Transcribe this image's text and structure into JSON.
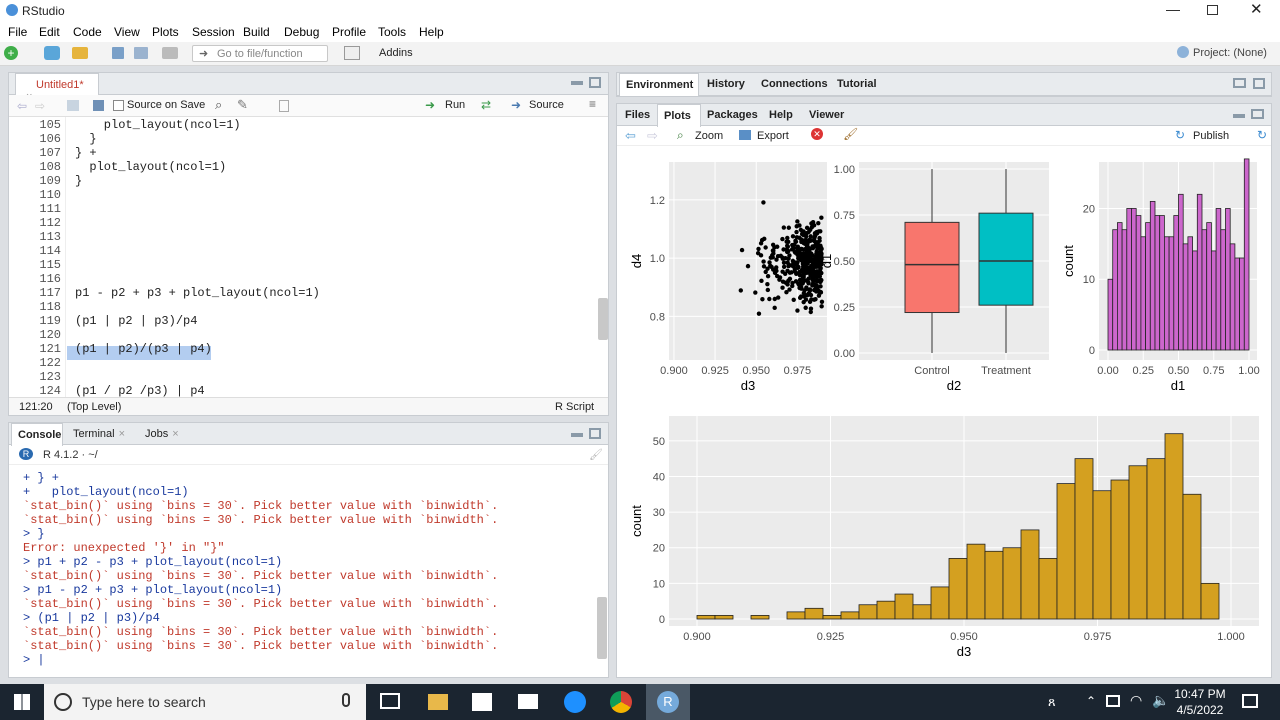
{
  "window": {
    "title": "RStudio"
  },
  "menu": [
    "File",
    "Edit",
    "Code",
    "View",
    "Plots",
    "Session",
    "Build",
    "Debug",
    "Profile",
    "Tools",
    "Help"
  ],
  "toolbar": {
    "goto_placeholder": "Go to file/function",
    "addins": "Addins",
    "project": "Project: (None)"
  },
  "editor": {
    "tab": "Untitled1*",
    "source_on_save": "Source on Save",
    "run": "Run",
    "source": "Source",
    "lines": [
      {
        "n": "105",
        "t": "    plot_layout(ncol=1)"
      },
      {
        "n": "106",
        "t": "  }"
      },
      {
        "n": "107",
        "t": "} +"
      },
      {
        "n": "108",
        "t": "  plot_layout(ncol=1)"
      },
      {
        "n": "109",
        "t": "}"
      },
      {
        "n": "110",
        "t": ""
      },
      {
        "n": "111",
        "t": ""
      },
      {
        "n": "112",
        "t": ""
      },
      {
        "n": "113",
        "t": ""
      },
      {
        "n": "114",
        "t": ""
      },
      {
        "n": "115",
        "t": ""
      },
      {
        "n": "116",
        "t": ""
      },
      {
        "n": "117",
        "t": "p1 - p2 + p3 + plot_layout(ncol=1)"
      },
      {
        "n": "118",
        "t": ""
      },
      {
        "n": "119",
        "t": "(p1 | p2 | p3)/p4"
      },
      {
        "n": "120",
        "t": ""
      },
      {
        "n": "121",
        "t": "(p1 | p2)/(p3 | p4)"
      },
      {
        "n": "122",
        "t": ""
      },
      {
        "n": "123",
        "t": ""
      },
      {
        "n": "124",
        "t": "(p1 / p2 /p3) | p4"
      }
    ],
    "status_pos": "121:20",
    "status_scope": "(Top Level)",
    "status_type": "R Script"
  },
  "console": {
    "tabs": [
      "Console",
      "Terminal",
      "Jobs"
    ],
    "version": "R 4.1.2 · ~/",
    "lines": [
      {
        "c": "blue",
        "t": "+ } +"
      },
      {
        "c": "blue",
        "t": "+   plot_layout(ncol=1)"
      },
      {
        "c": "red",
        "t": "`stat_bin()` using `bins = 30`. Pick better value with `binwidth`."
      },
      {
        "c": "red",
        "t": "`stat_bin()` using `bins = 30`. Pick better value with `binwidth`."
      },
      {
        "c": "blue",
        "t": "> }"
      },
      {
        "c": "red",
        "t": "Error: unexpected '}' in \"}\""
      },
      {
        "c": "blue",
        "t": "> p1 + p2 - p3 + plot_layout(ncol=1)"
      },
      {
        "c": "red",
        "t": "`stat_bin()` using `bins = 30`. Pick better value with `binwidth`."
      },
      {
        "c": "blue",
        "t": "> p1 - p2 + p3 + plot_layout(ncol=1)"
      },
      {
        "c": "red",
        "t": "`stat_bin()` using `bins = 30`. Pick better value with `binwidth`."
      },
      {
        "c": "blue",
        "t": "> (p1 | p2 | p3)/p4"
      },
      {
        "c": "red",
        "t": "`stat_bin()` using `bins = 30`. Pick better value with `binwidth`."
      },
      {
        "c": "red",
        "t": "`stat_bin()` using `bins = 30`. Pick better value with `binwidth`."
      },
      {
        "c": "blue",
        "t": "> |"
      }
    ]
  },
  "env_tabs": [
    "Environment",
    "History",
    "Connections",
    "Tutorial"
  ],
  "files_tabs": [
    "Files",
    "Plots",
    "Packages",
    "Help",
    "Viewer"
  ],
  "plots_toolbar": {
    "zoom": "Zoom",
    "export": "Export",
    "publish": "Publish"
  },
  "taskbar": {
    "search": "Type here to search",
    "time": "10:47 PM",
    "date": "4/5/2022"
  },
  "chart_data": [
    {
      "type": "scatter",
      "xlabel": "d3",
      "ylabel": "d4",
      "xticks": [
        "0.900",
        "0.925",
        "0.950",
        "0.975"
      ],
      "yticks": [
        "0.8",
        "1.0",
        "1.2"
      ],
      "xlim": [
        0.897,
        0.993
      ],
      "ylim": [
        0.65,
        1.33
      ]
    },
    {
      "type": "box",
      "xlabel": "d2",
      "ylabel": "d1",
      "categories": [
        "Control",
        "Treatment"
      ],
      "yticks": [
        "0.00",
        "0.25",
        "0.50",
        "0.75",
        "1.00"
      ],
      "boxes": [
        {
          "min": 0.0,
          "q1": 0.22,
          "median": 0.48,
          "q3": 0.71,
          "max": 1.0,
          "color": "#F8766D"
        },
        {
          "min": 0.0,
          "q1": 0.26,
          "median": 0.5,
          "q3": 0.76,
          "max": 1.0,
          "color": "#00BFC4"
        }
      ]
    },
    {
      "type": "histogram",
      "xlabel": "d1",
      "ylabel": "count",
      "color": "#CC66CC",
      "xticks": [
        "0.00",
        "0.25",
        "0.50",
        "0.75",
        "1.00"
      ],
      "yticks": [
        "0",
        "10",
        "20"
      ],
      "xlim": [
        0,
        1
      ],
      "ylim": [
        0,
        26
      ],
      "values": [
        10,
        17,
        18,
        17,
        20,
        20,
        19,
        16,
        18,
        21,
        19,
        19,
        16,
        16,
        19,
        22,
        15,
        16,
        14,
        22,
        17,
        18,
        14,
        20,
        17,
        20,
        15,
        13,
        13,
        27
      ]
    },
    {
      "type": "histogram",
      "xlabel": "d3",
      "ylabel": "count",
      "color": "#D4A020",
      "xticks": [
        "0.900",
        "0.925",
        "0.950",
        "0.975",
        "1.000"
      ],
      "yticks": [
        "0",
        "10",
        "20",
        "30",
        "40",
        "50"
      ],
      "xlim": [
        0.897,
        1.0
      ],
      "ylim": [
        -1,
        54
      ],
      "values": [
        1,
        1,
        0,
        1,
        0,
        2,
        3,
        1,
        2,
        4,
        5,
        7,
        4,
        9,
        17,
        21,
        19,
        20,
        25,
        17,
        38,
        45,
        36,
        39,
        43,
        45,
        52,
        35,
        10
      ]
    }
  ]
}
